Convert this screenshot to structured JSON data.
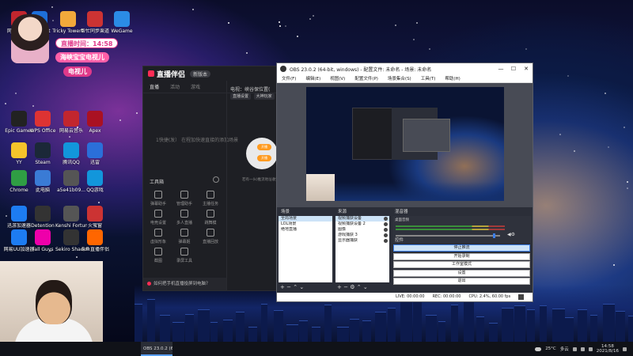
{
  "desktop": {
    "icons": [
      {
        "label": "Microsoft",
        "color": "#1e6fd9"
      },
      {
        "label": "Tricky Towers",
        "color": "#f2a93b"
      },
      {
        "label": "帮忙同步渠道",
        "color": "#c33"
      },
      {
        "label": "WeGame",
        "color": "#2b8be5"
      },
      {
        "label": "Epic Games",
        "color": "#222"
      },
      {
        "label": "WPS Office",
        "color": "#d33"
      },
      {
        "label": "网易云音乐",
        "color": "#c2262e"
      },
      {
        "label": "Apex",
        "color": "#a12"
      },
      {
        "label": "YY",
        "color": "#f6c42b"
      },
      {
        "label": "Steam",
        "color": "#1b2838"
      },
      {
        "label": "腾讯QQ",
        "color": "#1296db"
      },
      {
        "label": "迅雷",
        "color": "#2b6fd9"
      },
      {
        "label": "Chrome",
        "color": "#2f9e44"
      },
      {
        "label": "此电脑",
        "color": "#3a7bd5"
      },
      {
        "label": "a5e41b09...",
        "color": "#555"
      },
      {
        "label": "QQ游戏",
        "color": "#1296db"
      },
      {
        "label": "迅游加速器",
        "color": "#1d7cf2"
      },
      {
        "label": "Detention",
        "color": "#333"
      },
      {
        "label": "Kenshi Fortune...",
        "color": "#555"
      },
      {
        "label": "火萤窗",
        "color": "#c33"
      },
      {
        "label": "网易UU加速器",
        "color": "#1d7cf2"
      },
      {
        "label": "Fall Guys",
        "color": "#e0a"
      },
      {
        "label": "Sekiro Shadow...",
        "color": "#333"
      },
      {
        "label": "斗鱼直播伴侣",
        "color": "#f60"
      },
      {
        "label": "网易云音乐",
        "color": "#c2262e"
      }
    ]
  },
  "overlay": {
    "time_label": "直播时间：14:58",
    "mode_label": "海峡宝宝电视儿",
    "platform_label": "电视儿"
  },
  "zhibo": {
    "logo": "直播伴侣",
    "version": "新版本",
    "tabs": [
      "直播",
      "活动",
      "游戏"
    ],
    "placeholder": "1快捷(发）   在程加快速直接的添加场景",
    "right_header": "电视：峡谷保位置(",
    "right_tags": [
      "直播设置",
      "大神玩家"
    ],
    "btn1": "开播",
    "btn2": "开播",
    "right_note": "若有一(k)推流地址收到本地哦",
    "tools_title": "工具箱",
    "tools": [
      {
        "label": "弹幕助手"
      },
      {
        "label": "管理助手"
      },
      {
        "label": "主播任务"
      },
      {
        "label": "电竞设置"
      },
      {
        "label": "多人直播"
      },
      {
        "label": "跳舞模"
      },
      {
        "label": "虚拟形象"
      },
      {
        "label": "弹幕姬"
      },
      {
        "label": "直播回放"
      },
      {
        "label": "截图"
      },
      {
        "label": "录屏工具"
      }
    ],
    "bottom_tip": "如何把手机直播投屏到电脑？"
  },
  "obs": {
    "title": "OBS 23.0.2 (64-bit, windows) - 配置文件: 未命名 - 场景: 未命名",
    "menu": [
      "文件(F)",
      "编辑(E)",
      "视图(V)",
      "配置文件(P)",
      "场景集合(S)",
      "工具(T)",
      "帮助(H)"
    ],
    "scenes_header": "场景",
    "scenes": [
      "全局场景",
      "LOL场景",
      "绝地直播"
    ],
    "sources_header": "来源",
    "sources": [
      "视频捕获设备",
      "视频捕获设备 2",
      "图像",
      "游戏捕获 3",
      "显示器捕获"
    ],
    "mixer_header": "混音器",
    "mixer_label": "桌面音频",
    "mixer_level": 0.94,
    "controls_header": "控件",
    "controls": [
      "停止推流",
      "开始录制",
      "工作室模式",
      "设置",
      "退出"
    ],
    "status": {
      "live": "LIVE: 00:00:00",
      "rec": "REC: 00:00:00",
      "cpu": "CPU: 2.4%, 60.00 fps"
    }
  },
  "taskbar": {
    "task_label": "OBS 23.0.2 (64-bi...",
    "temperature": "25°C",
    "weather": "多云",
    "time": "14:58",
    "date": "2021/8/16"
  }
}
